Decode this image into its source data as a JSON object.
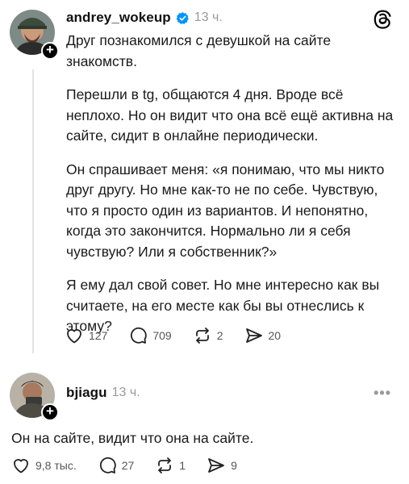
{
  "post": {
    "username": "andrey_wokeup",
    "time": "13 ч.",
    "paragraphs": [
      "Друг познакомился с девушкой на сайте\nзнакомств.",
      "Перешли в tg, общаются 4 дня. Вроде всё\nнеплохо. Но он видит что она всё ещё активна на\nсайте, сидит в онлайне периодически.",
      "Он спрашивает меня: «я понимаю, что мы никто\nдруг другу. Но мне как-то не по себе. Чувствую,\nчто я просто один из вариантов. И непонятно,\nкогда это закончится. Нормально ли я себя\nчувствую? Или я собственник?»",
      "Я ему дал свой совет. Но мне интересно как вы\nсчитаете, на его месте как бы вы отнеслись к\nэтому?"
    ],
    "likes": "127",
    "comments": "709",
    "reposts": "2",
    "shares": "20"
  },
  "reply": {
    "username": "bjiagu",
    "time": "13 ч.",
    "text": "Он на сайте, видит что она на сайте.",
    "likes": "9,8 тыс.",
    "comments": "27",
    "reposts": "1",
    "shares": "9"
  },
  "colors": {
    "verified": "#0095f6",
    "muted": "#9a9a9a"
  },
  "icons": [
    "threads-logo-icon",
    "verified-icon",
    "heart-icon",
    "comment-icon",
    "repost-icon",
    "share-icon",
    "more-icon",
    "plus-icon"
  ]
}
